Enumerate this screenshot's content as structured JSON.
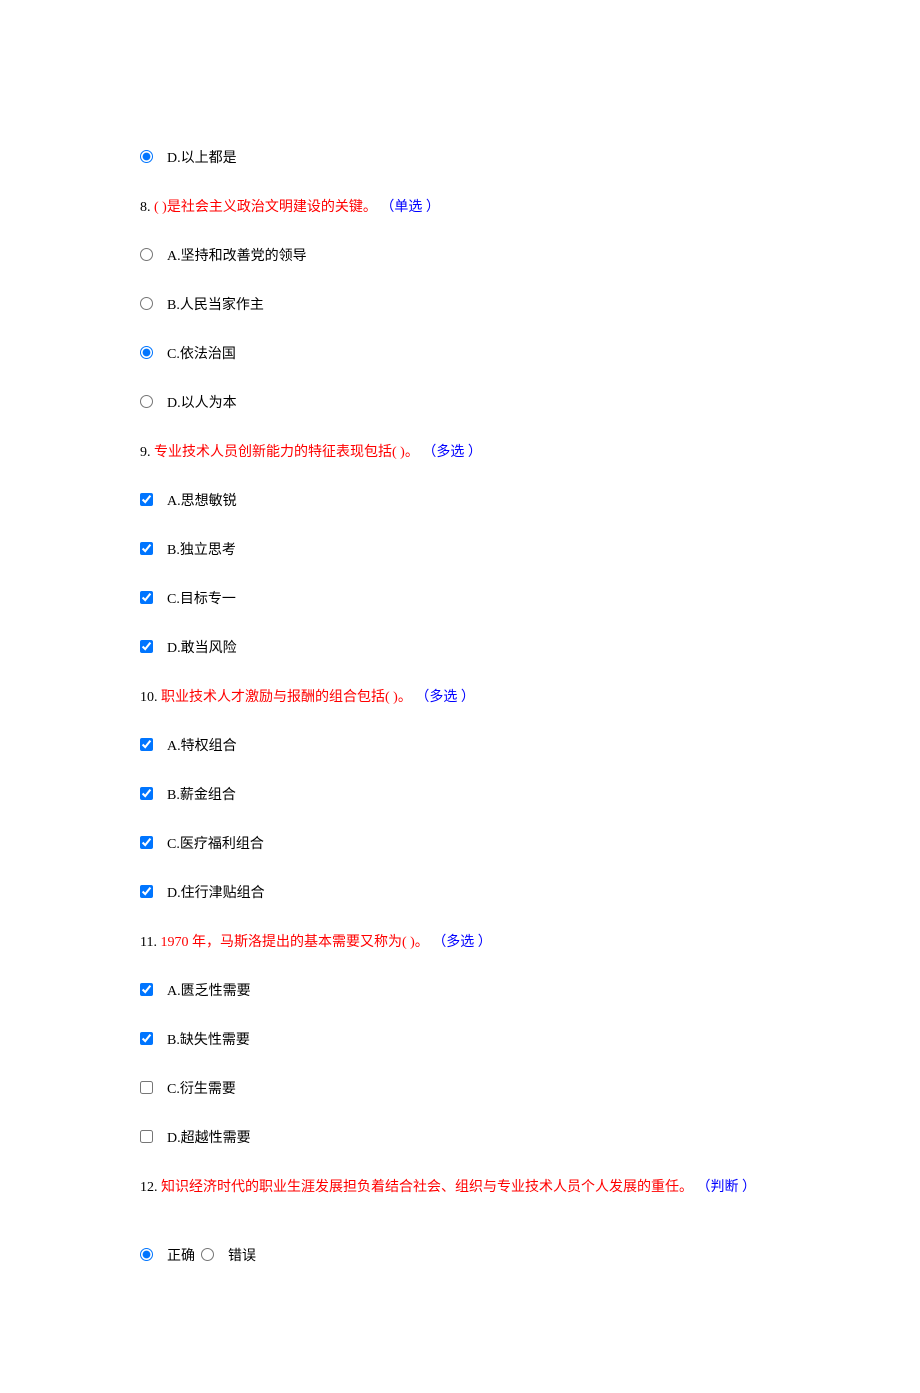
{
  "questions": [
    {
      "number": "",
      "text": "",
      "type_label": "",
      "input_type": "radio",
      "options": [
        {
          "letter": "D.",
          "text": "以上都是",
          "checked": true
        }
      ]
    },
    {
      "number": "8.",
      "text": "( )是社会主义政治文明建设的关键。",
      "type_label": "（单选 ）",
      "input_type": "radio",
      "options": [
        {
          "letter": "A.",
          "text": "坚持和改善党的领导",
          "checked": false
        },
        {
          "letter": "B.",
          "text": "人民当家作主",
          "checked": false
        },
        {
          "letter": "C.",
          "text": "依法治国",
          "checked": true
        },
        {
          "letter": "D.",
          "text": "以人为本",
          "checked": false
        }
      ]
    },
    {
      "number": "9.",
      "text": "专业技术人员创新能力的特征表现包括( )。",
      "type_label": "（多选 ）",
      "input_type": "checkbox",
      "options": [
        {
          "letter": "A.",
          "text": "思想敏锐",
          "checked": true
        },
        {
          "letter": "B.",
          "text": "独立思考",
          "checked": true
        },
        {
          "letter": "C.",
          "text": "目标专一",
          "checked": true
        },
        {
          "letter": "D.",
          "text": "敢当风险",
          "checked": true
        }
      ]
    },
    {
      "number": "10.",
      "text": "职业技术人才激励与报酬的组合包括( )。",
      "type_label": "（多选 ）",
      "input_type": "checkbox",
      "options": [
        {
          "letter": "A.",
          "text": "特权组合",
          "checked": true
        },
        {
          "letter": "B.",
          "text": "薪金组合",
          "checked": true
        },
        {
          "letter": "C.",
          "text": "医疗福利组合",
          "checked": true
        },
        {
          "letter": "D.",
          "text": "住行津贴组合",
          "checked": true
        }
      ]
    },
    {
      "number": "11.",
      "text": "1970 年，马斯洛提出的基本需要又称为( )。",
      "type_label": "（多选 ）",
      "input_type": "checkbox",
      "options": [
        {
          "letter": "A.",
          "text": "匮乏性需要",
          "checked": true
        },
        {
          "letter": "B.",
          "text": "缺失性需要",
          "checked": true
        },
        {
          "letter": "C.",
          "text": "衍生需要",
          "checked": false
        },
        {
          "letter": "D.",
          "text": "超越性需要",
          "checked": false
        }
      ]
    },
    {
      "number": "12.",
      "text": "知识经济时代的职业生涯发展担负着结合社会、组织与专业技术人员个人发展的重任。",
      "type_label": "（判断 ）",
      "input_type": "radio",
      "inline": true,
      "options": [
        {
          "letter": "",
          "text": "正确",
          "checked": true
        },
        {
          "letter": "",
          "text": "错误",
          "checked": false
        }
      ]
    }
  ]
}
